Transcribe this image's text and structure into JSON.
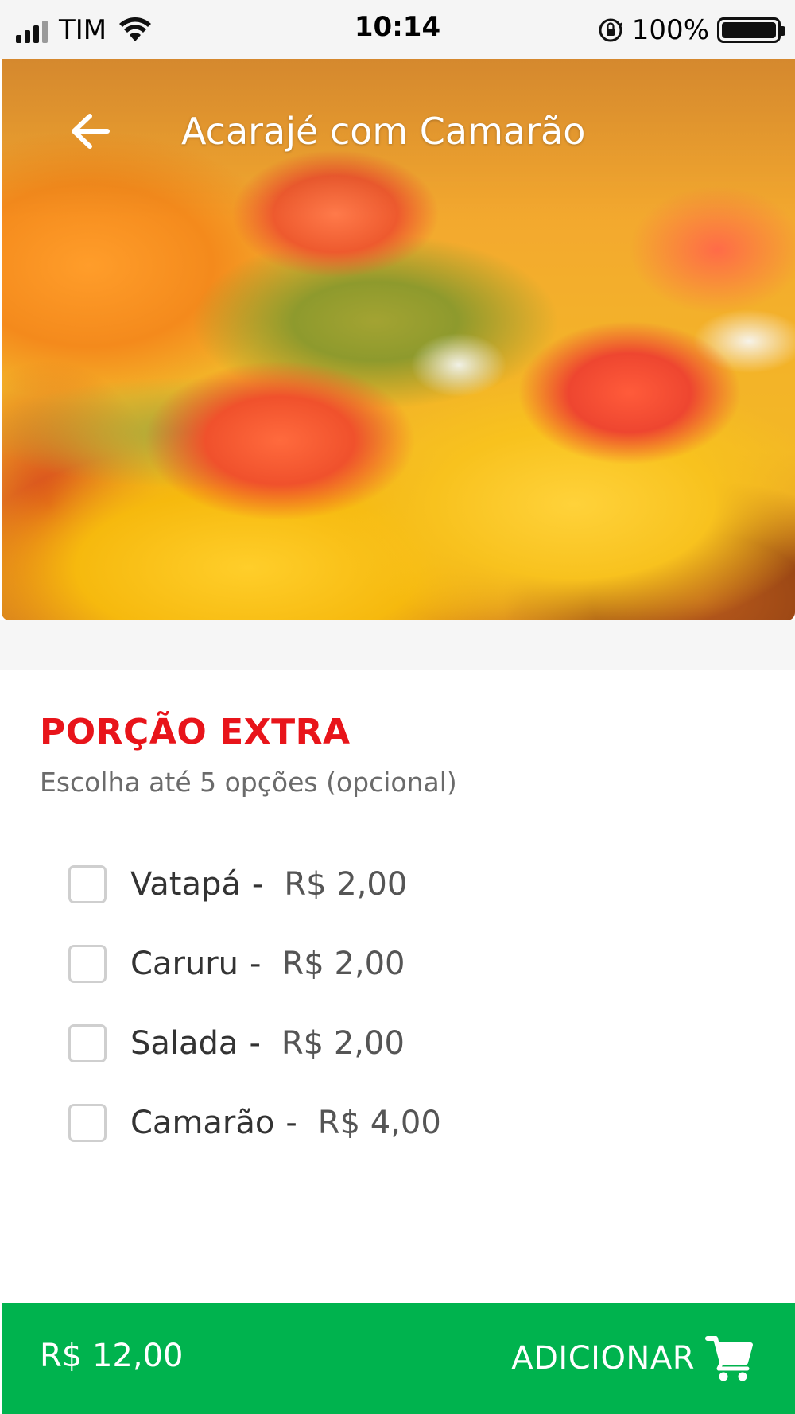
{
  "status_bar": {
    "carrier": "TIM",
    "time": "10:14",
    "battery_percent": "100%"
  },
  "header": {
    "title": "Acarajé com Camarão",
    "back_icon": "arrow-left-icon"
  },
  "section": {
    "title": "PORÇÃO EXTRA",
    "subtitle": "Escolha até 5 opções (opcional)",
    "options": [
      {
        "name": "Vatapá",
        "separator": "-",
        "price": "R$ 2,00",
        "checked": false
      },
      {
        "name": "Caruru",
        "separator": "-",
        "price": "R$ 2,00",
        "checked": false
      },
      {
        "name": "Salada",
        "separator": "-",
        "price": "R$ 2,00",
        "checked": false
      },
      {
        "name": "Camarão",
        "separator": "-",
        "price": "R$ 4,00",
        "checked": false
      }
    ]
  },
  "footer": {
    "total": "R$ 12,00",
    "add_label": "ADICIONAR",
    "cart_icon": "cart-icon"
  },
  "colors": {
    "accent_red": "#e8141a",
    "footer_green": "#00b34e"
  }
}
